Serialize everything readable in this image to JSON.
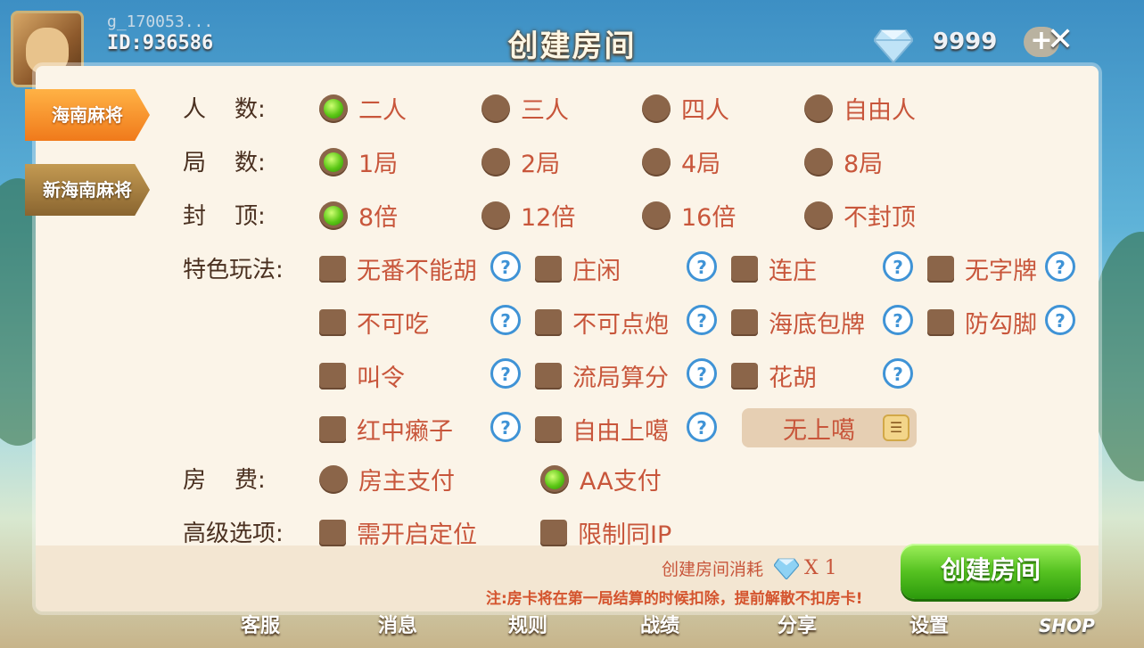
{
  "header": {
    "username": "g_170053...",
    "user_id": "ID:936586",
    "title": "创建房间",
    "gem_count": "9999",
    "plus_label": "+",
    "close_label": "✕"
  },
  "tabs": [
    {
      "label": "海南麻将",
      "active": true
    },
    {
      "label": "新海南麻将",
      "active": false
    }
  ],
  "rows": {
    "players": {
      "label": [
        "人",
        "数:"
      ],
      "options": [
        "二人",
        "三人",
        "四人",
        "自由人"
      ],
      "selected": 0
    },
    "rounds": {
      "label": [
        "局",
        "数:"
      ],
      "options": [
        "1局",
        "2局",
        "4局",
        "8局"
      ],
      "selected": 0
    },
    "cap": {
      "label": [
        "封",
        "顶:"
      ],
      "options": [
        "8倍",
        "12倍",
        "16倍",
        "不封顶"
      ],
      "selected": 0
    },
    "special": {
      "label": "特色玩法:",
      "items": [
        "无番不能胡",
        "庄闲",
        "连庄",
        "无字牌",
        "不可吃",
        "不可点炮",
        "海底包牌",
        "防勾脚",
        "叫令",
        "流局算分",
        "花胡",
        "红中癞子",
        "自由上噶"
      ],
      "dropdown_value": "无上噶"
    },
    "fee": {
      "label": [
        "房",
        "费:"
      ],
      "options": [
        "房主支付",
        "AA支付"
      ],
      "selected": 1
    },
    "advanced": {
      "label": "高级选项:",
      "options": [
        "需开启定位",
        "限制同IP"
      ]
    }
  },
  "footer": {
    "cost_label": "创建房间消耗",
    "cost_mult": "X 1",
    "note": "注:房卡将在第一局结算的时候扣除，提前解散不扣房卡!",
    "create_button": "创建房间"
  },
  "bottom_nav": [
    "客服",
    "消息",
    "规则",
    "战绩",
    "分享",
    "设置"
  ],
  "shop_label": "SHOP",
  "colors": {
    "accent_text": "#c8563b",
    "radio_on": "#5cc716",
    "panel_bg": "#fbf4e8"
  }
}
